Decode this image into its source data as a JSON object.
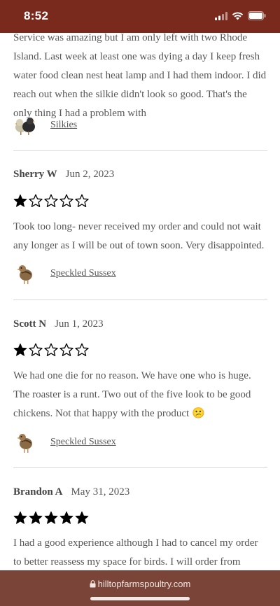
{
  "status_bar": {
    "time": "8:52"
  },
  "reviews": [
    {
      "name": "",
      "date": "",
      "rating": null,
      "text": "Service was amazing but I am only left with two Rhode Island. Last week at least one was dying a day I keep fresh water food clean nest heat lamp and I had them indoor. I did reach out when the silkie didn't look so good. That's the only thing I had a problem with",
      "product": "Silkies",
      "product_icon": "silkie-chicks-icon"
    },
    {
      "name": "Sherry W",
      "date": "Jun 2, 2023",
      "rating": 1,
      "text": "Took too long- never received my order and could not wait any longer as I will be out of town soon. Very disappointed.",
      "product": "Speckled Sussex",
      "product_icon": "chick-icon"
    },
    {
      "name": "Scott N",
      "date": "Jun 1, 2023",
      "rating": 1,
      "text": "We had one die for no reason. We have one who is huge. The roaster is a runt. Two out of the five look to be good chickens. Not that happy with the product 😕",
      "product": "Speckled Sussex",
      "product_icon": "chick-icon"
    },
    {
      "name": "Brandon A",
      "date": "May 31, 2023",
      "rating": 5,
      "text": "I had a good experience although I had to cancel my order to better reassess my space for birds. I will order from hilltop farms next time",
      "product": "",
      "product_icon": ""
    }
  ],
  "browser": {
    "url": "hilltopfarmspoultry.com"
  },
  "colors": {
    "status_bar": "#7a2a1c",
    "bottom_bar": "#7a4538",
    "text": "#555555"
  }
}
